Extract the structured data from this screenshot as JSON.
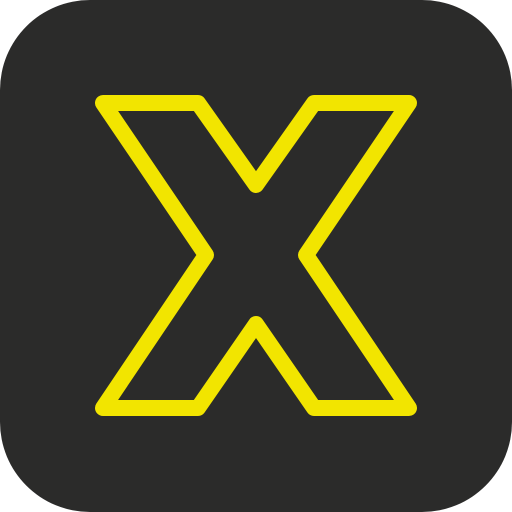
{
  "icon": {
    "semantic": "x-logo-icon",
    "colors": {
      "background": "#2b2b2a",
      "stroke": "#f2e500"
    }
  }
}
